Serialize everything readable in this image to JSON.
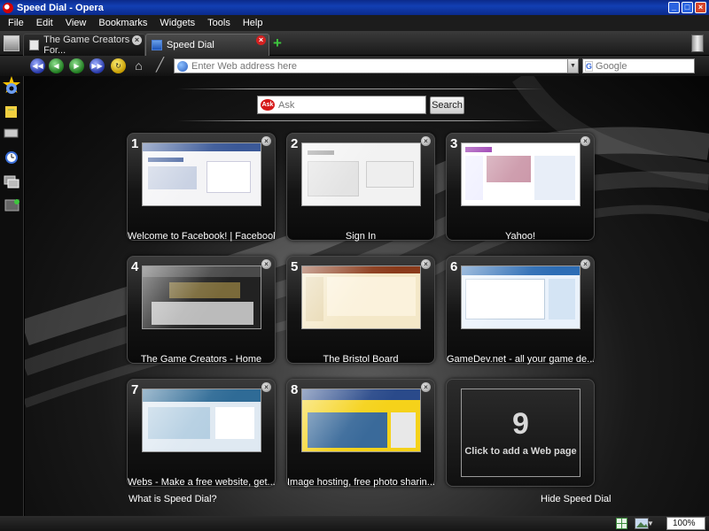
{
  "window": {
    "title": "Speed Dial - Opera"
  },
  "menu": [
    "File",
    "Edit",
    "View",
    "Bookmarks",
    "Widgets",
    "Tools",
    "Help"
  ],
  "tabs": [
    {
      "label": "The Game Creators For..."
    },
    {
      "label": "Speed Dial"
    }
  ],
  "address_bar": {
    "placeholder": "Enter Web address here"
  },
  "search_engine": {
    "placeholder": "Google"
  },
  "ask": {
    "placeholder": "Ask",
    "logo_text": "Ask",
    "button_label": "Search"
  },
  "dials": [
    {
      "number": "1",
      "caption": "Welcome to Facebook! | Facebook"
    },
    {
      "number": "2",
      "caption": "Sign In"
    },
    {
      "number": "3",
      "caption": "Yahoo!"
    },
    {
      "number": "4",
      "caption": "The Game Creators - Home"
    },
    {
      "number": "5",
      "caption": "The Bristol Board"
    },
    {
      "number": "6",
      "caption": "GameDev.net - all your game de..."
    },
    {
      "number": "7",
      "caption": "Webs - Make a free website, get..."
    },
    {
      "number": "8",
      "caption": "Image hosting, free photo sharin..."
    },
    {
      "number": "9",
      "caption": "Click to add a Web page"
    }
  ],
  "footer": {
    "what_is": "What is Speed Dial?",
    "hide": "Hide Speed Dial"
  },
  "status": {
    "zoom": "100%"
  },
  "colors": {
    "titlebar": "#123fb3",
    "accent_close": "#d32020",
    "new_tab": "#3ec63e"
  }
}
